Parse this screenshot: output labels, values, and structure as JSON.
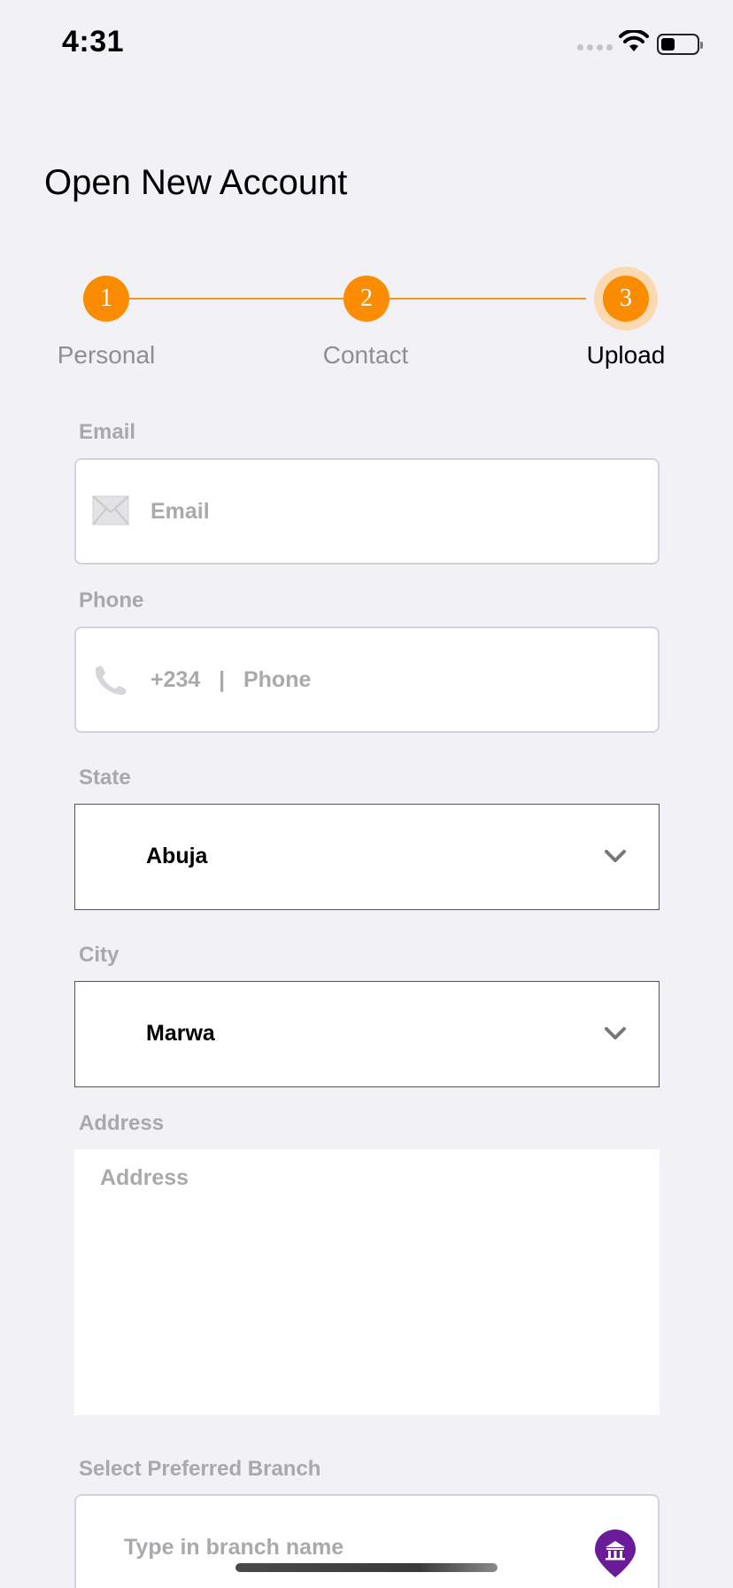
{
  "status_bar": {
    "time": "4:31"
  },
  "header": {
    "title": "Open New Account"
  },
  "stepper": {
    "steps": [
      {
        "number": "1",
        "label": "Personal"
      },
      {
        "number": "2",
        "label": "Contact"
      },
      {
        "number": "3",
        "label": "Upload"
      }
    ],
    "active_step": 3,
    "accent_color": "#fb8c00"
  },
  "form": {
    "email": {
      "label": "Email",
      "placeholder": "Email",
      "icon": "envelope-icon"
    },
    "phone": {
      "label": "Phone",
      "prefix": "+234   |   Phone",
      "icon": "phone-icon"
    },
    "state": {
      "label": "State",
      "value": "Abuja"
    },
    "city": {
      "label": "City",
      "value": "Marwa"
    },
    "address": {
      "label": "Address",
      "placeholder": "Address"
    },
    "branch": {
      "label": "Select Preferred Branch",
      "placeholder": "Type in branch name",
      "icon": "bank-pin-icon"
    }
  }
}
